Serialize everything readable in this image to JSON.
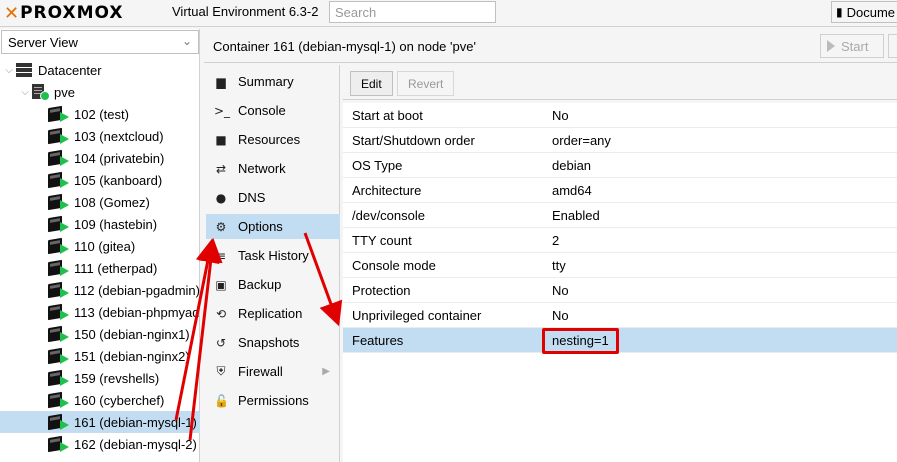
{
  "topbar": {
    "logo_text": "PROXMOX",
    "version": "Virtual Environment 6.3-2",
    "search_placeholder": "Search",
    "docs_label": "Docume"
  },
  "tree": {
    "view": "Server View",
    "datacenter": "Datacenter",
    "node": "pve",
    "containers": [
      "102 (test)",
      "103 (nextcloud)",
      "104 (privatebin)",
      "105 (kanboard)",
      "108 (Gomez)",
      "109 (hastebin)",
      "110 (gitea)",
      "111 (etherpad)",
      "112 (debian-pgadmin)",
      "113 (debian-phpmyad",
      "150 (debian-nginx1)",
      "151 (debian-nginx2)",
      "159 (revshells)",
      "160 (cyberchef)",
      "161 (debian-mysql-1)",
      "162 (debian-mysql-2)"
    ],
    "selected_index": 14
  },
  "header": {
    "title": "Container 161 (debian-mysql-1) on node 'pve'",
    "start_label": "Start"
  },
  "menu": {
    "items": [
      {
        "label": "Summary",
        "icon": "book-icon"
      },
      {
        "label": "Console",
        "icon": "terminal-icon"
      },
      {
        "label": "Resources",
        "icon": "cube-icon"
      },
      {
        "label": "Network",
        "icon": "exchange-icon"
      },
      {
        "label": "DNS",
        "icon": "globe-icon"
      },
      {
        "label": "Options",
        "icon": "gear-icon"
      },
      {
        "label": "Task History",
        "icon": "list-icon"
      },
      {
        "label": "Backup",
        "icon": "floppy-icon"
      },
      {
        "label": "Replication",
        "icon": "retweet-icon"
      },
      {
        "label": "Snapshots",
        "icon": "history-icon"
      },
      {
        "label": "Firewall",
        "icon": "shield-icon"
      },
      {
        "label": "Permissions",
        "icon": "unlock-icon"
      }
    ],
    "active_index": 5
  },
  "toolbar": {
    "edit_label": "Edit",
    "revert_label": "Revert"
  },
  "options": {
    "rows": [
      {
        "key": "Start at boot",
        "value": "No"
      },
      {
        "key": "Start/Shutdown order",
        "value": "order=any"
      },
      {
        "key": "OS Type",
        "value": "debian"
      },
      {
        "key": "Architecture",
        "value": "amd64"
      },
      {
        "key": "/dev/console",
        "value": "Enabled"
      },
      {
        "key": "TTY count",
        "value": "2"
      },
      {
        "key": "Console mode",
        "value": "tty"
      },
      {
        "key": "Protection",
        "value": "No"
      },
      {
        "key": "Unprivileged container",
        "value": "No"
      },
      {
        "key": "Features",
        "value": "nesting=1"
      }
    ],
    "selected_index": 9
  },
  "colors": {
    "selection": "#c2ddf2",
    "annotation": "#e00000",
    "running": "#21bf4b",
    "brand": "#e57000"
  }
}
